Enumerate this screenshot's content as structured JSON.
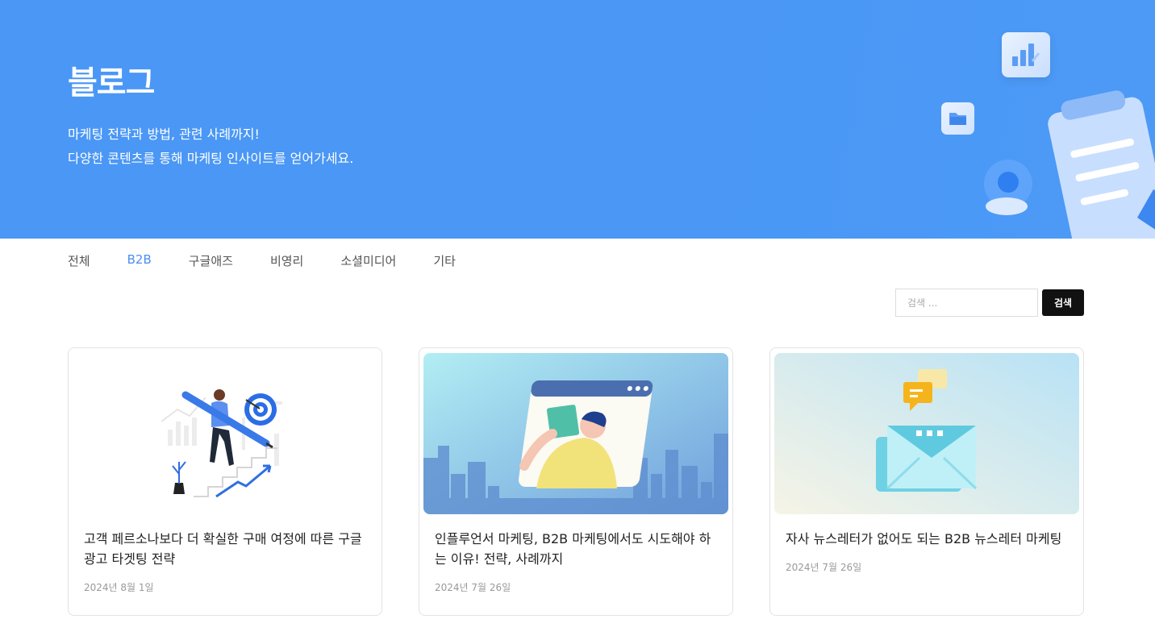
{
  "hero": {
    "title": "블로그",
    "subtitle_line1": "마케팅 전략과 방법, 관련 사례까지!",
    "subtitle_line2": "다양한 콘텐츠를 통해 마케팅 인사이트를 얻어가세요.",
    "background_color": "#4a97f5"
  },
  "tabs": [
    {
      "label": "전체",
      "active": false
    },
    {
      "label": "B2B",
      "active": true
    },
    {
      "label": "구글애즈",
      "active": false
    },
    {
      "label": "비영리",
      "active": false
    },
    {
      "label": "소셜미디어",
      "active": false
    },
    {
      "label": "기타",
      "active": false
    }
  ],
  "accent_color": "#4a8ff0",
  "search": {
    "placeholder": "검색 ...",
    "button_label": "검색"
  },
  "posts": [
    {
      "title": "고객 페르소나보다 더 확실한 구매 여정에 따른 구글 광고 타겟팅 전략",
      "date": "2024년 8월 1일",
      "thumbnail": "woman-climbing-stairs-with-pencil-target-illustration"
    },
    {
      "title": "인플루언서 마케팅, B2B 마케팅에서도 시도해야 하는 이유! 전략, 사례까지",
      "date": "2024년 7월 26일",
      "thumbnail": "man-with-book-in-browser-window-illustration"
    },
    {
      "title": "자사 뉴스레터가 없어도 되는 B2B 뉴스레터 마케팅",
      "date": "2024년 7월 26일",
      "thumbnail": "envelope-with-chat-bubbles-illustration"
    }
  ]
}
